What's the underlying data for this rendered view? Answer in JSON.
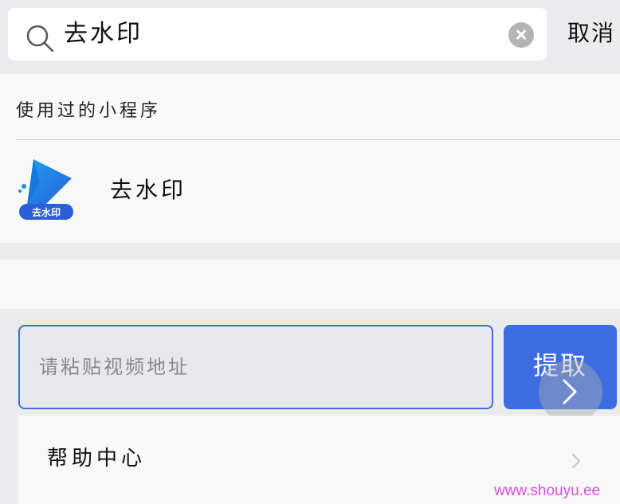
{
  "search": {
    "query": "去水印",
    "cancel_label": "取消"
  },
  "recent": {
    "section_title": "使用过的小程序",
    "apps": [
      {
        "name": "去水印",
        "logo_text": "去水印"
      }
    ]
  },
  "extract": {
    "placeholder": "请粘贴视频地址",
    "button_label": "提取"
  },
  "help": {
    "label": "帮助中心"
  },
  "watermark": {
    "text": "www.shouyu.ee"
  },
  "colors": {
    "accent": "#3d6de0",
    "background": "#ebebed",
    "panel": "#f8f8f9",
    "watermark": "#d650d6"
  }
}
